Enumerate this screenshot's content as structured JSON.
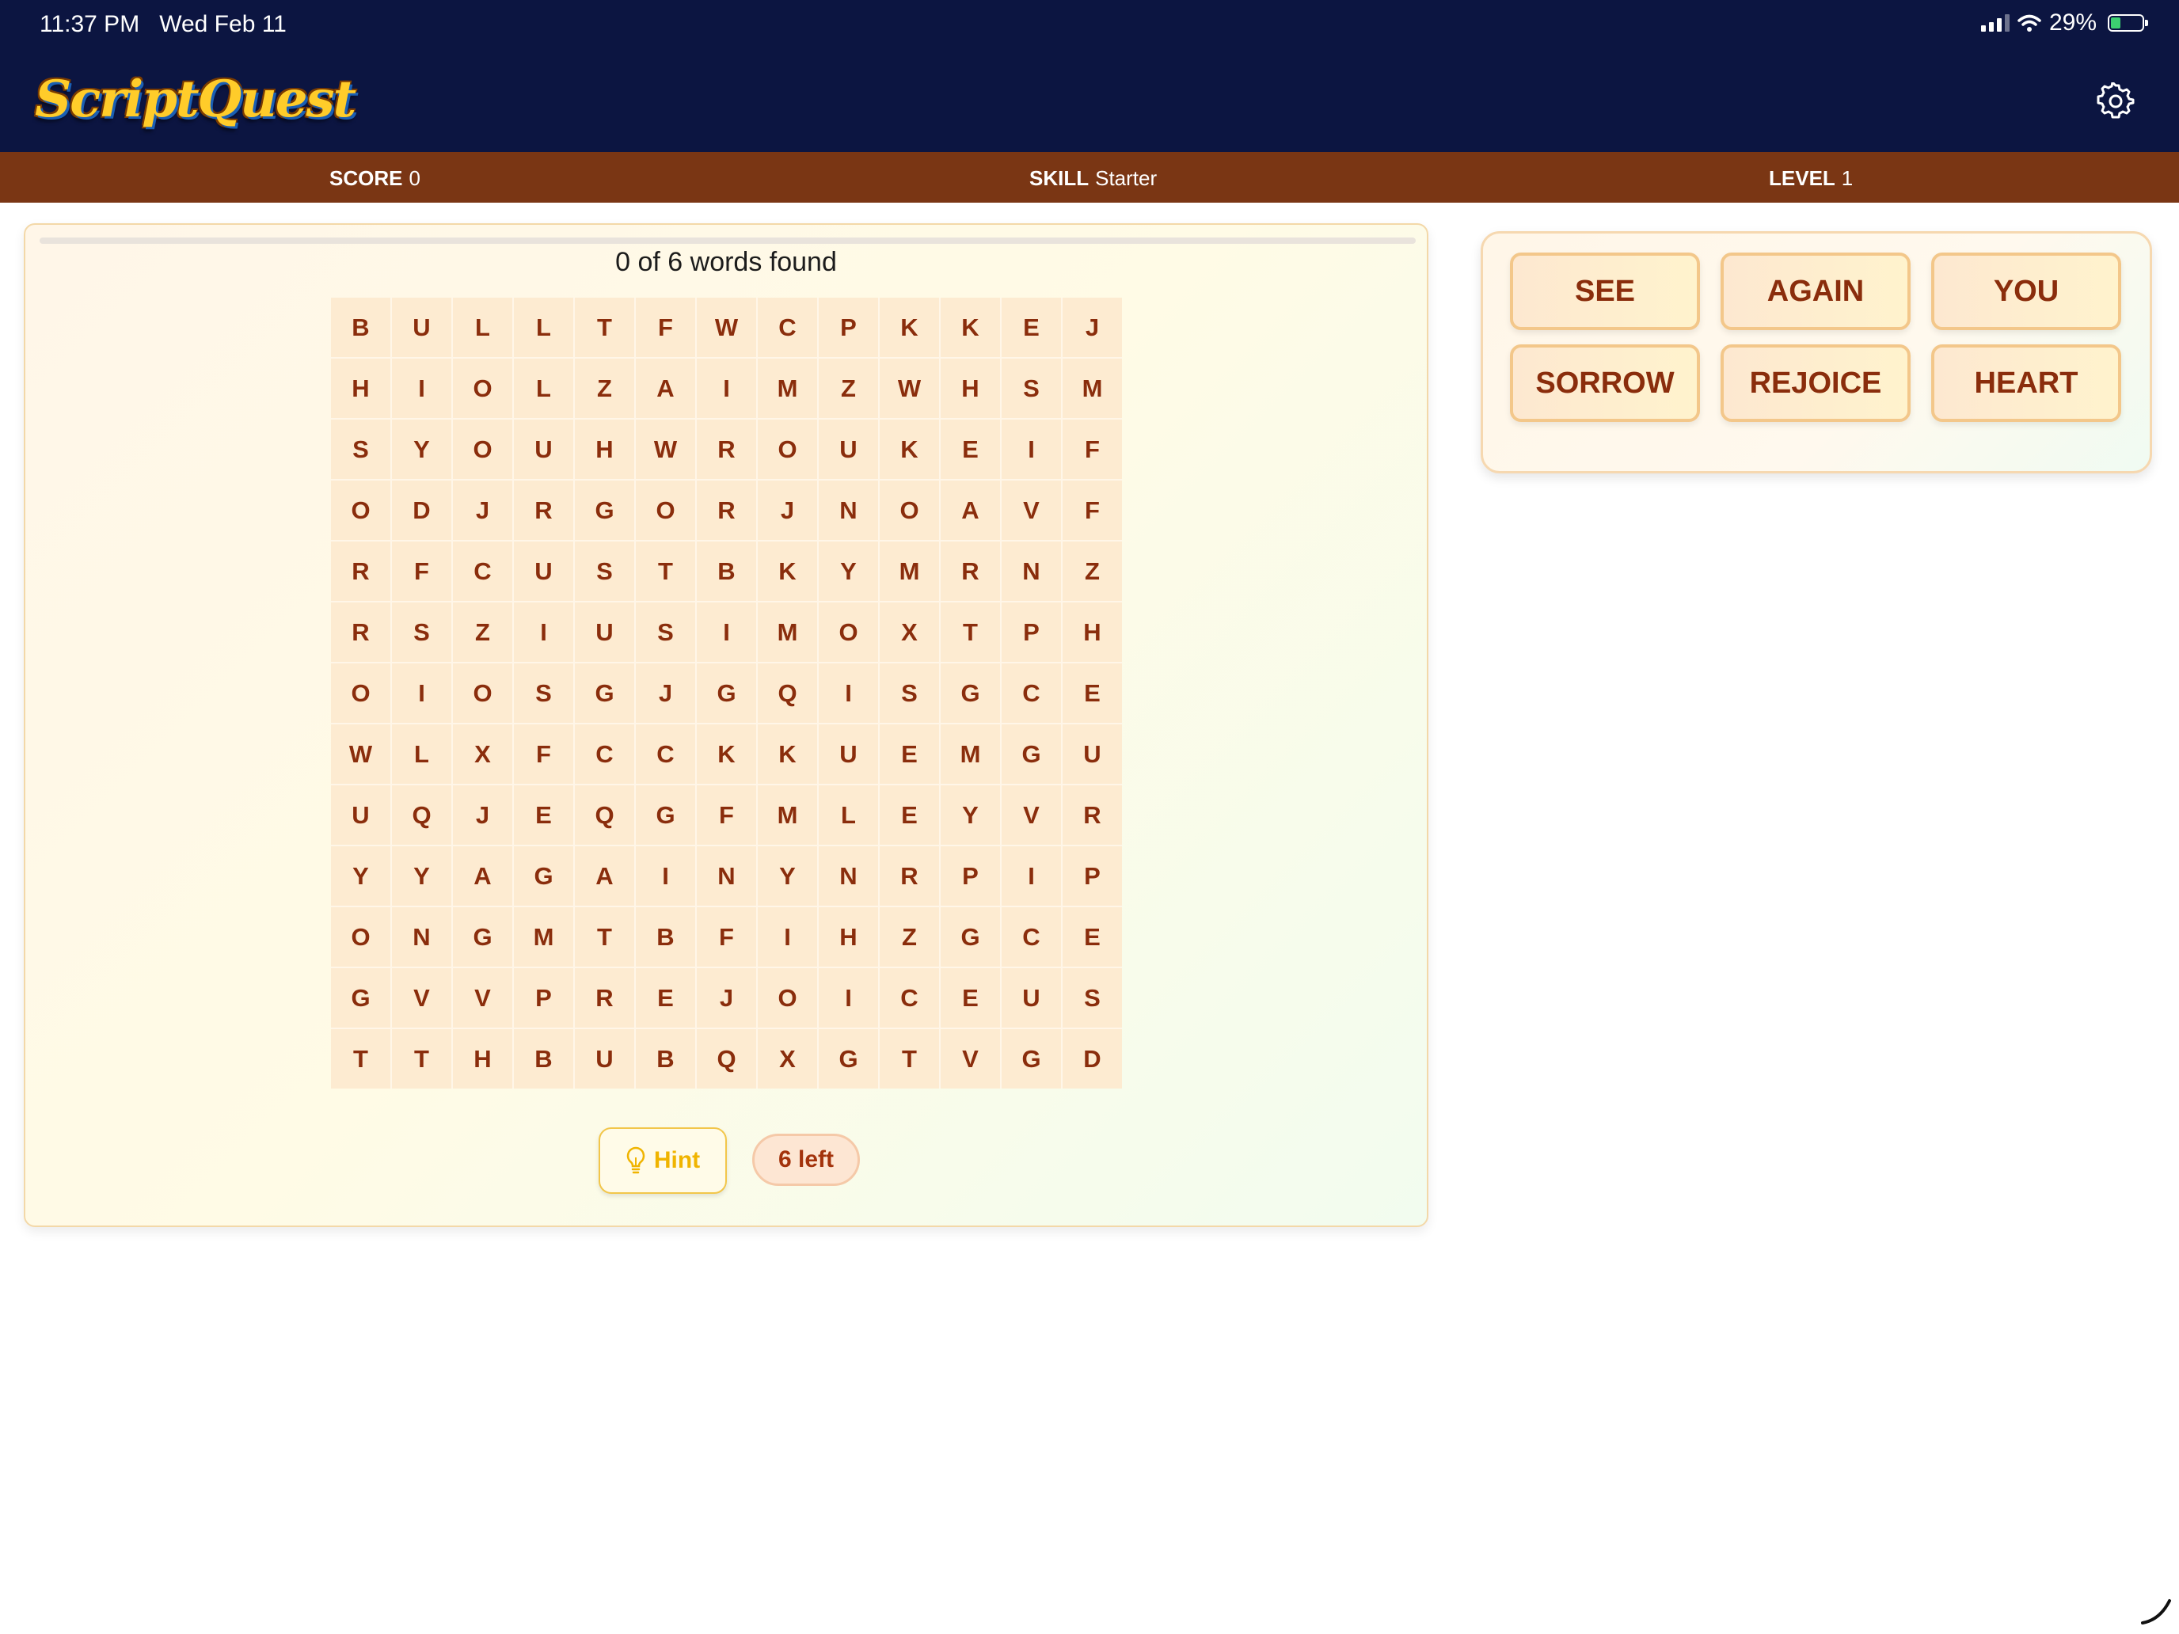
{
  "status_bar": {
    "time": "11:37 PM",
    "date": "Wed Feb 11",
    "battery": "29%"
  },
  "app": {
    "logo_text": "ScriptQuest",
    "settings_icon": "gear-icon"
  },
  "stats": {
    "score_label": "SCORE",
    "score_value": "0",
    "skill_label": "SKILL",
    "skill_value": "Starter",
    "level_label": "LEVEL",
    "level_value": "1"
  },
  "puzzle": {
    "progress_text": "0 of 6 words found",
    "progress_fraction": 0,
    "grid": [
      [
        "B",
        "U",
        "L",
        "L",
        "T",
        "F",
        "W",
        "C",
        "P",
        "K",
        "K",
        "E",
        "J"
      ],
      [
        "H",
        "I",
        "O",
        "L",
        "Z",
        "A",
        "I",
        "M",
        "Z",
        "W",
        "H",
        "S",
        "M"
      ],
      [
        "S",
        "Y",
        "O",
        "U",
        "H",
        "W",
        "R",
        "O",
        "U",
        "K",
        "E",
        "I",
        "F"
      ],
      [
        "O",
        "D",
        "J",
        "R",
        "G",
        "O",
        "R",
        "J",
        "N",
        "O",
        "A",
        "V",
        "F"
      ],
      [
        "R",
        "F",
        "C",
        "U",
        "S",
        "T",
        "B",
        "K",
        "Y",
        "M",
        "R",
        "N",
        "Z"
      ],
      [
        "R",
        "S",
        "Z",
        "I",
        "U",
        "S",
        "I",
        "M",
        "O",
        "X",
        "T",
        "P",
        "H"
      ],
      [
        "O",
        "I",
        "O",
        "S",
        "G",
        "J",
        "G",
        "Q",
        "I",
        "S",
        "G",
        "C",
        "E"
      ],
      [
        "W",
        "L",
        "X",
        "F",
        "C",
        "C",
        "K",
        "K",
        "U",
        "E",
        "M",
        "G",
        "U"
      ],
      [
        "U",
        "Q",
        "J",
        "E",
        "Q",
        "G",
        "F",
        "M",
        "L",
        "E",
        "Y",
        "V",
        "R"
      ],
      [
        "Y",
        "Y",
        "A",
        "G",
        "A",
        "I",
        "N",
        "Y",
        "N",
        "R",
        "P",
        "I",
        "P"
      ],
      [
        "O",
        "N",
        "G",
        "M",
        "T",
        "B",
        "F",
        "I",
        "H",
        "Z",
        "G",
        "C",
        "E"
      ],
      [
        "G",
        "V",
        "V",
        "P",
        "R",
        "E",
        "J",
        "O",
        "I",
        "C",
        "E",
        "U",
        "S"
      ],
      [
        "T",
        "T",
        "H",
        "B",
        "U",
        "B",
        "Q",
        "X",
        "G",
        "T",
        "V",
        "G",
        "D"
      ]
    ],
    "hint_label": "Hint",
    "left_label": "6 left"
  },
  "words": [
    "SEE",
    "AGAIN",
    "YOU",
    "SORROW",
    "REJOICE",
    "HEART"
  ],
  "colors": {
    "header_bg": "#0c1541",
    "stats_bar_bg": "#7a3614",
    "cell_bg": "#fdebd1",
    "letter": "#8a2d0c",
    "hint": "#f0b400"
  }
}
